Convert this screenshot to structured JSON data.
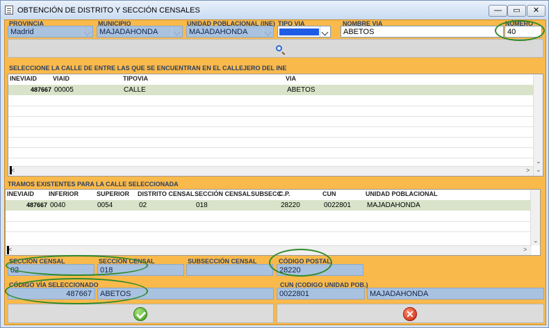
{
  "window": {
    "title": "OBTENCIÓN DE DISTRITO Y SECCIÓN CENSALES",
    "min_glyph": "—",
    "max_glyph": "▭",
    "close_glyph": "✕"
  },
  "filters": {
    "provincia": {
      "label": "PROVINCIA",
      "value": "Madrid"
    },
    "municipio": {
      "label": "MUNICIPIO",
      "value": "MAJADAHONDA"
    },
    "unidad_poblacional": {
      "label": "UNIDAD POBLACIONAL (INE)",
      "value": "MAJADAHONDA"
    },
    "tipo_via": {
      "label": "TIPO VIA",
      "value": ""
    },
    "nombre_via": {
      "label": "NOMBRE VIA",
      "value": "ABETOS"
    },
    "numero": {
      "label": "NÚMERO",
      "value": "40"
    }
  },
  "search": {
    "icon": "magnifier-icon"
  },
  "calles": {
    "title": "SELECCIONE LA CALLE DE ENTRE LAS QUE SE ENCUENTRAN EN EL CALLEJERO DEL INE",
    "columns": [
      "INEVIAID",
      "VIAID",
      "TIPOVIA",
      "VIA"
    ],
    "rows": [
      {
        "ineviaid": "487667",
        "viaid": "00005",
        "tipovia": "CALLE",
        "via": "ABETOS"
      }
    ]
  },
  "tramos": {
    "title": "TRAMOS EXISTENTES PARA LA CALLE SELECCIONADA",
    "columns": [
      "INEVIAID",
      "INFERIOR",
      "SUPERIOR",
      "DISTRITO CENSAL",
      "SECCIÓN CENSAL",
      "SUBSECC",
      "C.P.",
      "CUN",
      "UNIDAD POBLACIONAL"
    ],
    "rows": [
      {
        "ineviaid": "487667",
        "inferior": "0040",
        "superior": "0054",
        "distrito": "02",
        "seccion": "018",
        "subsecc": "",
        "cp": "28220",
        "cun": "0022801",
        "unidad": "MAJADAHONDA"
      }
    ]
  },
  "results": {
    "distrito": {
      "label": "SECCIÓN CENSAL",
      "value": "02"
    },
    "seccion": {
      "label": "SECCIÓN CENSAL",
      "value": "018"
    },
    "subseccion": {
      "label": "SUBSECCIÓN CENSAL",
      "value": ""
    },
    "codigo_postal": {
      "label": "CÓDIGO POSTAL",
      "value": "28220"
    },
    "codigo_via": {
      "label": "CÓDIGO VÍA SELECCIONADO",
      "value": "487667",
      "nombre": "ABETOS"
    },
    "cun": {
      "label": "CUN (CODIGO UNIDAD POB.)",
      "value": "0022801",
      "nombre": "MAJADAHONDA"
    }
  },
  "actions": {
    "accept_icon": "check-icon",
    "cancel_icon": "cancel-icon",
    "cancel_glyph": "✕"
  },
  "colors": {
    "panel": "#f9b94b",
    "readonly": "#a9c2e0",
    "selected_row": "#d9e3c9",
    "highlight": "#2f8a2a"
  }
}
